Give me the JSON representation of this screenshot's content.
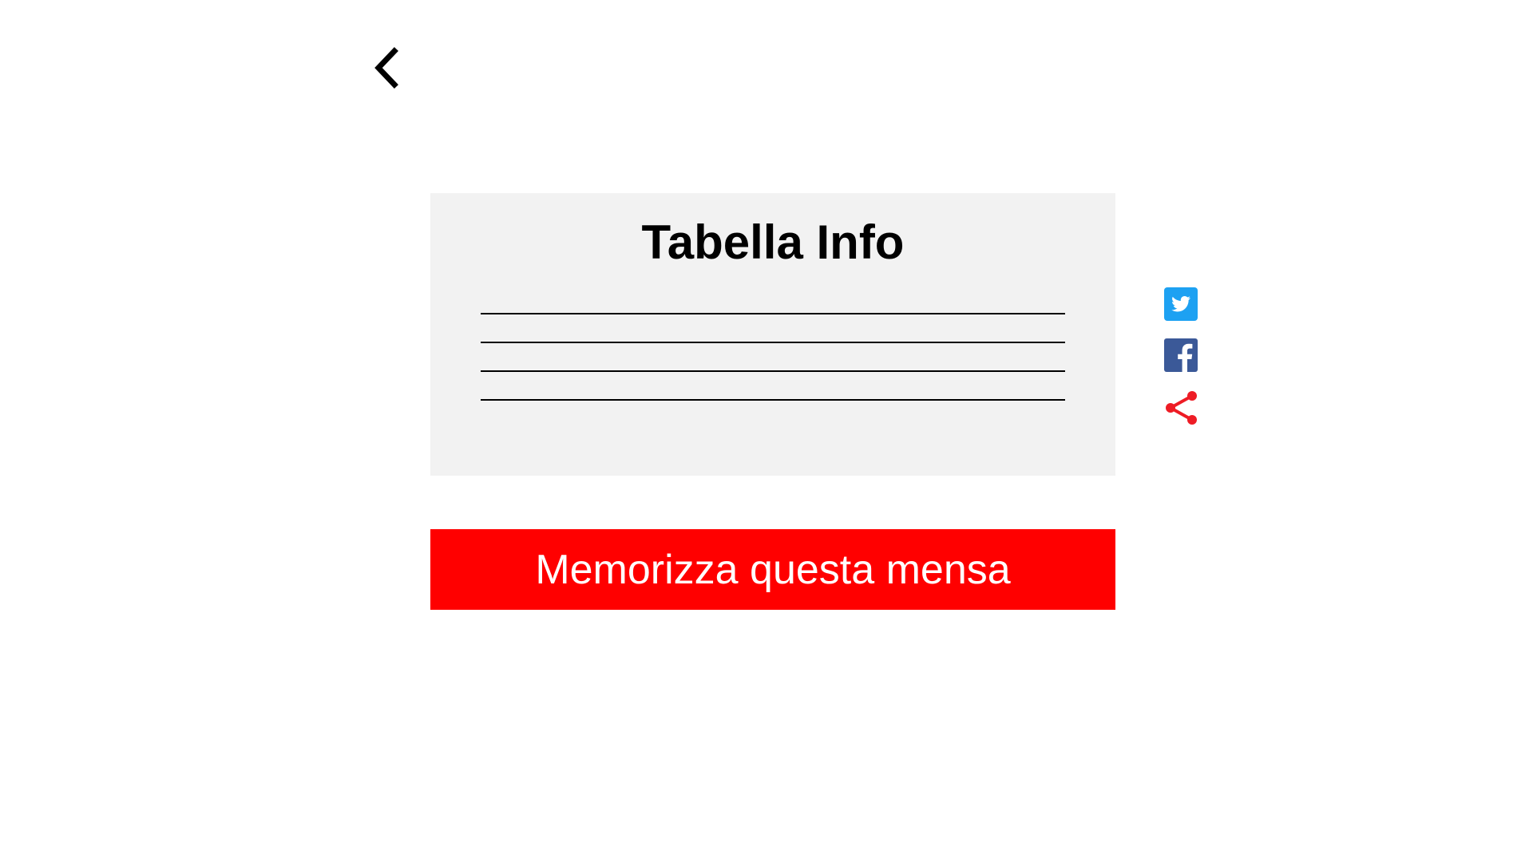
{
  "navigation": {
    "back_icon": "chevron-left-icon"
  },
  "info_card": {
    "title": "Tabella Info",
    "line_count": 4
  },
  "actions": {
    "save_label": "Memorizza questa mensa"
  },
  "share": {
    "items": [
      {
        "icon": "twitter-icon",
        "color": "#1da1f2"
      },
      {
        "icon": "facebook-icon",
        "color": "#3b5998"
      },
      {
        "icon": "share-icon",
        "color": "#ee1c25"
      }
    ]
  },
  "colors": {
    "accent": "#ff0000",
    "card_background": "#f2f2f2",
    "text": "#000000"
  }
}
